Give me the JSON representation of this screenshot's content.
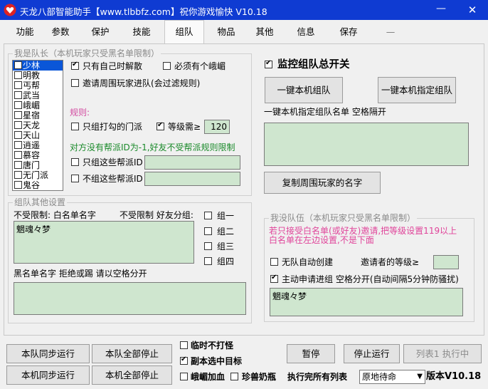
{
  "window": {
    "title": "天龙八部智能助手【www.tlbbfz.com】祝你游戏愉快 V10.18",
    "min_glyph": "—",
    "close_glyph": "✕"
  },
  "tabs": [
    "功能",
    "参数",
    "保护",
    "技能",
    "组队",
    "物品",
    "其他",
    "信息",
    "保存",
    "—"
  ],
  "leader_group": {
    "title": "我是队长（本机玩家只受黑名单限制）",
    "factions": [
      "少林",
      "明教",
      "丐帮",
      "武当",
      "峨嵋",
      "星宿",
      "天龙",
      "天山",
      "逍遥",
      "慕容",
      "唐门",
      "无门派",
      "鬼谷"
    ],
    "only_own_disband": "只有自己时解散",
    "need_emei": "必须有个峨嵋",
    "invite_nearby": "邀请周围玩家进队(会过滤规则)",
    "rules_label": "规则:",
    "only_checked_factions": "只组打勾的门派",
    "level_need": "等级需≥",
    "level_value": "120",
    "guild_note": "对方没有帮派ID为-1,好友不受帮派规则限制",
    "only_guild_ids": "只组这些帮派ID",
    "not_guild_ids": "不组这些帮派ID"
  },
  "other_group": {
    "title": "组队其他设置",
    "whitelist_label": "不受限制: 白名单名字",
    "friend_group_label": "不受限制 好友分组:",
    "groups": [
      "组一",
      "组二",
      "组三",
      "组四"
    ],
    "whitelist_value": "魍魂々梦",
    "blacklist_label": "黑名单名字 拒绝或踢 请以空格分开"
  },
  "right": {
    "monitor_label": "监控组队总开关",
    "one_key_team": "一键本机组队",
    "one_key_designated": "一键本机指定组队",
    "designated_list_label": "一键本机指定组队名单 空格隔开",
    "copy_names": "复制周围玩家的名字"
  },
  "no_team_group": {
    "title": "我没队伍（本机玩家只受黑名单限制）",
    "hint": "若只接受白名单(或好友)邀请,把等级设置119以上白名单在左边设置,不是下面",
    "no_team_auto_create": "无队自动创建",
    "inviter_level": "邀请者的等级≥",
    "auto_apply": "主动申请进组 空格分开(自动间隔5分钟防骚扰)",
    "apply_value": "魍魂々梦"
  },
  "bottom": {
    "team_sync_run": "本队同步运行",
    "team_all_stop": "本队全部停止",
    "machine_sync_run": "本机同步运行",
    "machine_all_stop": "本机全部停止",
    "temp_no_monster": "临时不打怪",
    "dungeon_select_target": "副本选中目标",
    "emei_heal": "峨嵋加血",
    "pet_milk": "珍兽奶瓶",
    "pause": "暂停",
    "stop_run": "停止运行",
    "list1_running": "列表1 执行中",
    "after_list_label": "执行完所有列表",
    "after_list_value": "原地待命",
    "version": "版本V10.18"
  },
  "colors": {
    "titlebar": "#0f3bd2",
    "input_green": "#cfe6cf",
    "hint_pink": "#e0449a",
    "note_green": "#1a8a2a",
    "rule_pink": "#d24aa0",
    "selection": "#0a56d8"
  }
}
